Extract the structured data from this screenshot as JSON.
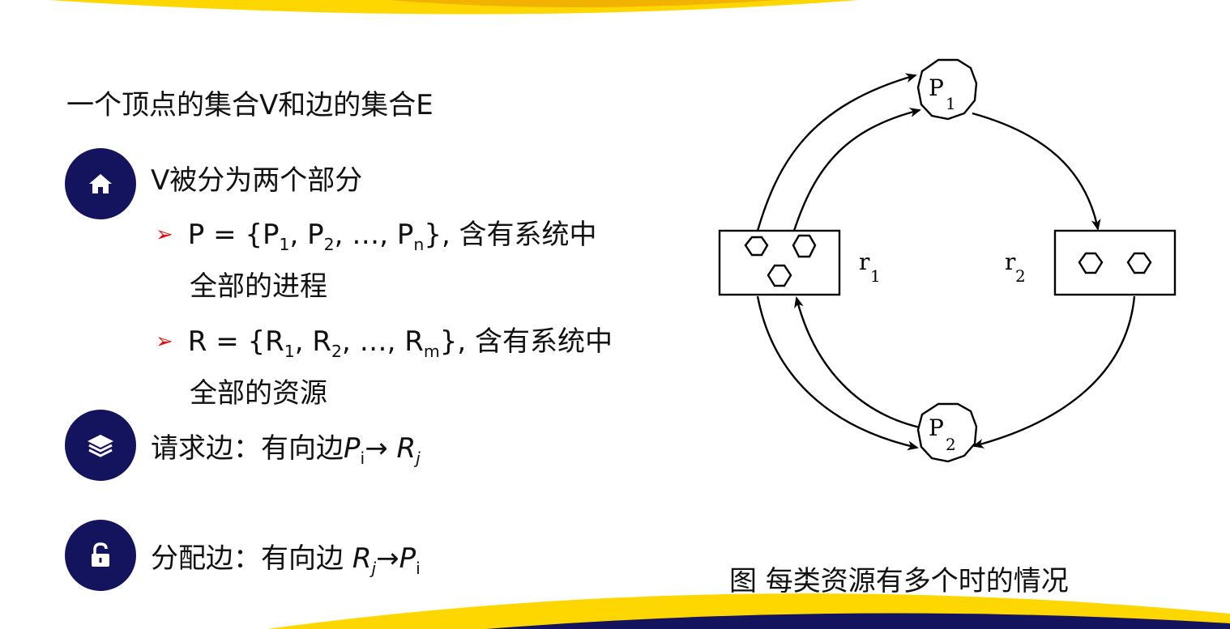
{
  "title": "一个顶点的集合V和边的集合E",
  "bullets": [
    {
      "icon": "home-icon",
      "label": "V被分为两个部分"
    },
    {
      "icon": "layers-icon",
      "label": "请求边：有向边",
      "edge_from": "P",
      "from_sub": "i",
      "arrow": "→",
      "edge_to": "R",
      "to_sub": "j"
    },
    {
      "icon": "unlock-icon",
      "label": "分配边：有向边 ",
      "edge_from": "R",
      "from_sub": "j",
      "arrow": "→",
      "edge_to": "P",
      "to_sub": "i"
    }
  ],
  "sub_items": [
    {
      "marker": "➢",
      "prefix": "P = {P",
      "s1": "1",
      "m1": ", P",
      "s2": "2",
      "m2": ", …, P",
      "s3": "n",
      "suffix": "}, 含有系统中",
      "line2": "全部的进程"
    },
    {
      "marker": "➢",
      "prefix": "R = {R",
      "s1": "1",
      "m1": ", R",
      "s2": "2",
      "m2": ", …, R",
      "s3": "m",
      "suffix": "}, 含有系统中",
      "line2": "全部的资源"
    }
  ],
  "diagram": {
    "p1": {
      "letter": "P",
      "sub": "1"
    },
    "p2": {
      "letter": "P",
      "sub": "2"
    },
    "r1": {
      "letter": "r",
      "sub": "1"
    },
    "r2": {
      "letter": "r",
      "sub": "2"
    },
    "r1_instances": 3,
    "r2_instances": 2
  },
  "caption": "图  每类资源有多个时的情况",
  "colors": {
    "accent_yellow": "#ffd700",
    "accent_navy": "#14135e",
    "marker_red": "#e01010"
  }
}
